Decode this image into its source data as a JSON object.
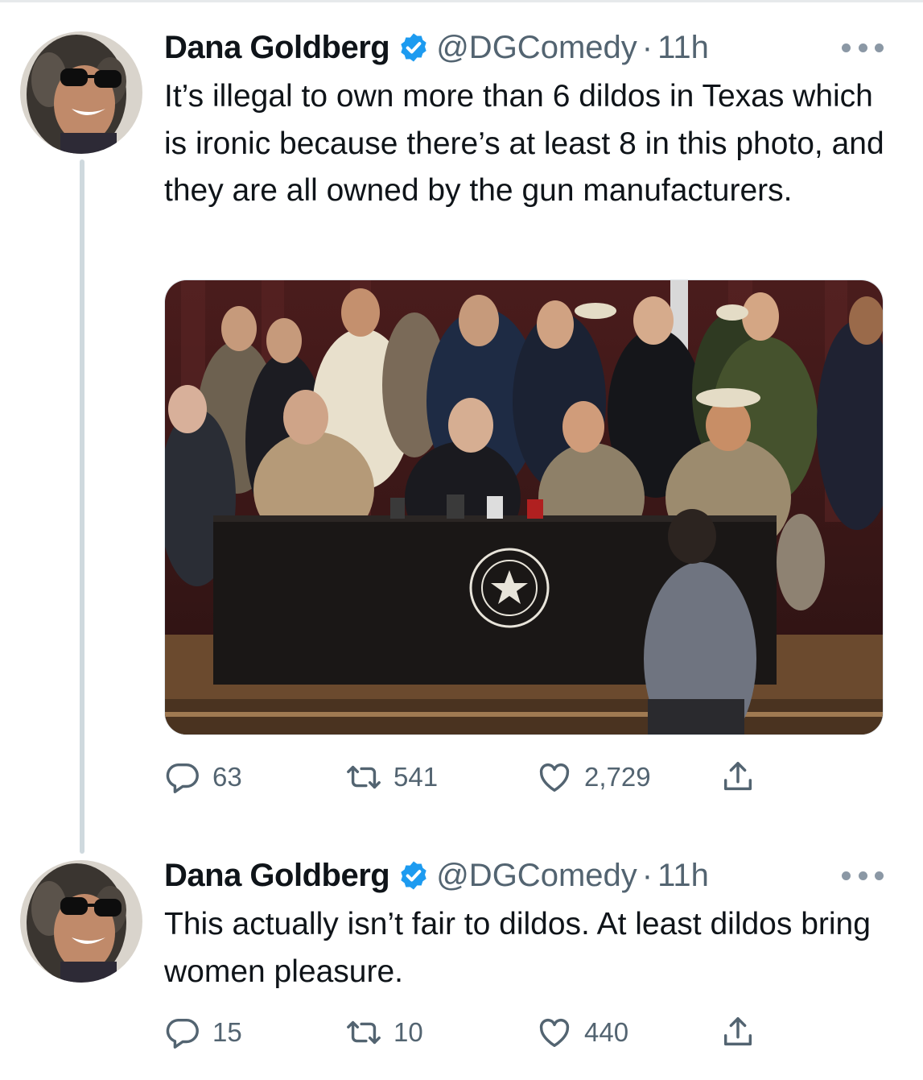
{
  "tweets": [
    {
      "author_name": "Dana Goldberg",
      "handle": "@DGComedy",
      "separator": "·",
      "time": "11h",
      "text": "It’s illegal to own more than 6 dildos in Texas which is ironic because there’s at least 8 in this photo, and they are all owned by the gun manufacturers.",
      "replies": "63",
      "retweets": "541",
      "likes": "2,729"
    },
    {
      "author_name": "Dana Goldberg",
      "handle": "@DGComedy",
      "separator": "·",
      "time": "11h",
      "text": "This actually isn’t fair to dildos. At least dildos bring women pleasure.",
      "replies": "15",
      "retweets": "10",
      "likes": "440"
    }
  ],
  "icons": {
    "verified": "verified-badge-icon",
    "more": "more-options-icon",
    "reply": "reply-icon",
    "retweet": "retweet-icon",
    "like": "like-icon",
    "share": "share-icon"
  },
  "colors": {
    "verified_blue": "#1d9bf0",
    "secondary_text": "#536471",
    "thread_line": "#cfd9de"
  }
}
